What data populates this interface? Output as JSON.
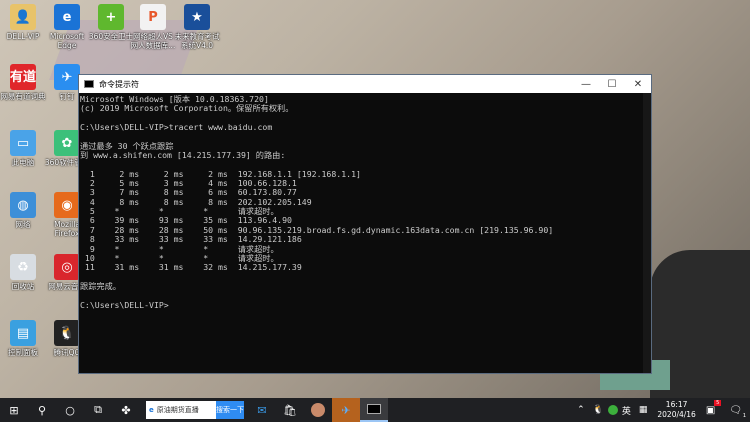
{
  "desktop": {
    "icons": [
      {
        "label": "DELL-VIP",
        "color": "#e8c36a",
        "glyph": "👤"
      },
      {
        "label": "Microsoft Edge",
        "color": "#1a73d6",
        "glyph": "e"
      },
      {
        "label": "360安全卫士",
        "color": "#5fb82e",
        "glyph": "+"
      },
      {
        "label": "网络超人VS 网人数据库...",
        "color": "#f2f2f2",
        "glyph": "P"
      },
      {
        "label": "未来教育考试 系统V4.0",
        "color": "#1a4f9a",
        "glyph": "★"
      },
      {
        "label": "网易有道词典",
        "color": "#e0262b",
        "glyph": "有道"
      },
      {
        "label": "钉钉",
        "color": "#2a8ef0",
        "glyph": "✈"
      },
      {
        "label": "此电脑",
        "color": "#4aa3e8",
        "glyph": "▭"
      },
      {
        "label": "360软件管家",
        "color": "#3cc07a",
        "glyph": "✿"
      },
      {
        "label": "网络",
        "color": "#3d8fd8",
        "glyph": "◍"
      },
      {
        "label": "Mozilla Firefox",
        "color": "#e66a1c",
        "glyph": "◉"
      },
      {
        "label": "回收站",
        "color": "#d8dde2",
        "glyph": "♻"
      },
      {
        "label": "网易云音乐",
        "color": "#d9262c",
        "glyph": "◎"
      },
      {
        "label": "控制面板",
        "color": "#3aa0e0",
        "glyph": "▤"
      },
      {
        "label": "腾讯QQ",
        "color": "#222222",
        "glyph": "🐧"
      }
    ]
  },
  "window": {
    "title": "命令提示符",
    "minimize": "—",
    "maximize": "☐",
    "close": "✕"
  },
  "console": {
    "lines_top": [
      "Microsoft Windows [版本 10.0.18363.720]",
      "(c) 2019 Microsoft Corporation。保留所有权利。",
      "",
      "C:\\Users\\DELL-VIP>tracert www.baidu.com",
      "",
      "通过最多 30 个跃点跟踪",
      "到 www.a.shifen.com [14.215.177.39] 的路由:",
      ""
    ],
    "hops": [
      [
        "1",
        "2 ms",
        "2 ms",
        "2 ms",
        "192.168.1.1 [192.168.1.1]"
      ],
      [
        "2",
        "5 ms",
        "3 ms",
        "4 ms",
        "100.66.128.1"
      ],
      [
        "3",
        "7 ms",
        "8 ms",
        "6 ms",
        "60.173.80.77"
      ],
      [
        "4",
        "8 ms",
        "8 ms",
        "8 ms",
        "202.102.205.149"
      ],
      [
        "5",
        "*",
        "*",
        "*",
        "请求超时。"
      ],
      [
        "6",
        "39 ms",
        "93 ms",
        "35 ms",
        "113.96.4.90"
      ],
      [
        "7",
        "28 ms",
        "28 ms",
        "50 ms",
        "90.96.135.219.broad.fs.gd.dynamic.163data.com.cn [219.135.96.90]"
      ],
      [
        "8",
        "33 ms",
        "33 ms",
        "33 ms",
        "14.29.121.186"
      ],
      [
        "9",
        "*",
        "*",
        "*",
        "请求超时。"
      ],
      [
        "10",
        "*",
        "*",
        "*",
        "请求超时。"
      ],
      [
        "11",
        "31 ms",
        "31 ms",
        "32 ms",
        "14.215.177.39"
      ]
    ],
    "done": "跟踪完成。",
    "prompt": "C:\\Users\\DELL-VIP>"
  },
  "taskbar": {
    "search_text": "原油期货直播",
    "search_button": "搜索一下",
    "ime": "英",
    "time": "16:17",
    "date": "2020/4/16",
    "notif_badge": "5",
    "action_center_count": "1"
  }
}
